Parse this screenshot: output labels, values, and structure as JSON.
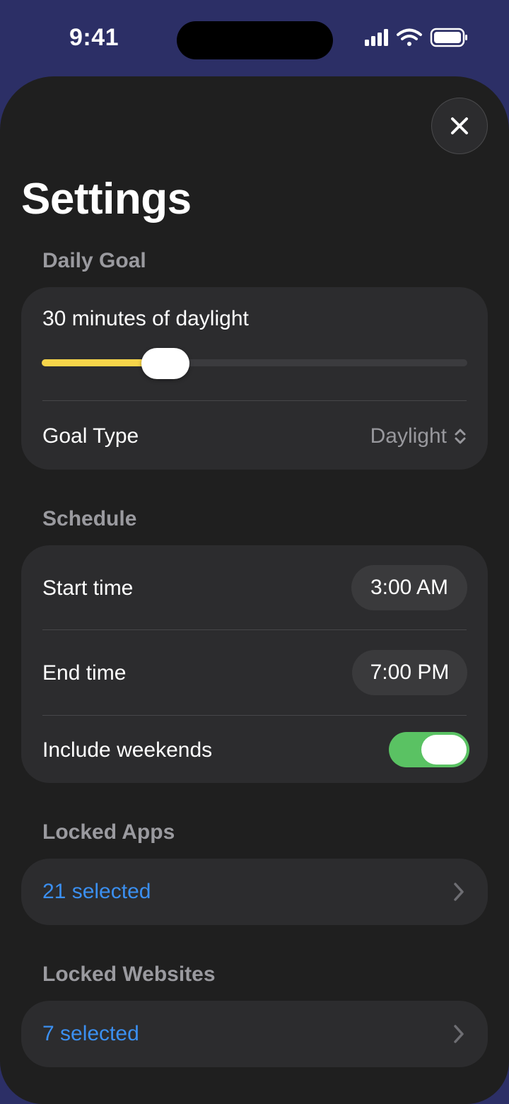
{
  "status_bar": {
    "time": "9:41",
    "icons": [
      "signal-icon",
      "wifi-icon",
      "battery-icon"
    ]
  },
  "header": {
    "title": "Settings",
    "close_icon": "close-icon"
  },
  "daily_goal": {
    "section_title": "Daily Goal",
    "goal_text": "30 minutes of daylight",
    "slider_fraction": 0.29,
    "goal_type_label": "Goal Type",
    "goal_type_value": "Daylight",
    "accent_color": "#f7d54a"
  },
  "schedule": {
    "section_title": "Schedule",
    "start_label": "Start time",
    "start_value": "3:00 AM",
    "end_label": "End time",
    "end_value": "7:00 PM",
    "weekends_label": "Include weekends",
    "weekends_on": true,
    "toggle_color": "#5ac263"
  },
  "locked_apps": {
    "section_title": "Locked Apps",
    "value": "21 selected"
  },
  "locked_websites": {
    "section_title": "Locked Websites",
    "value": "7 selected"
  },
  "link_color": "#3b8ff0"
}
